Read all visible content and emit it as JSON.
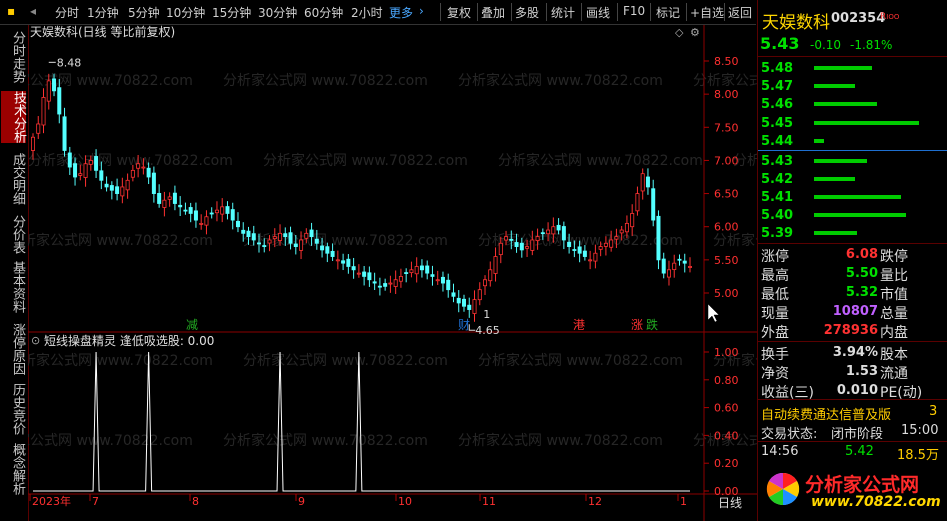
{
  "toolbar": {
    "items": [
      "分时",
      "1分钟",
      "5分钟",
      "10分钟",
      "15分钟",
      "30分钟",
      "60分钟",
      "2小时",
      "更多",
      "复权",
      "叠加",
      "多股",
      "统计",
      "画线",
      "F10",
      "标记",
      "+自选",
      "返回"
    ]
  },
  "side_tabs": [
    "分时走势",
    "技术分析",
    "成交明细",
    "分价表",
    "基本资料",
    "涨停原因",
    "历史竞价",
    "概念解析"
  ],
  "chart": {
    "title": "天娱数科(日线 等比前复权)",
    "watermark": "分析家公式网 www.70822.com",
    "y_ticks": [
      "8.50",
      "8.00",
      "7.50",
      "7.00",
      "6.50",
      "6.00",
      "5.50",
      "5.00"
    ],
    "high_label": "8.48",
    "low_label": "4.65",
    "marker_one": "1",
    "events": [
      "减",
      "财",
      "港",
      "涨",
      "跌"
    ],
    "indicator_label": "短线操盘精灵 逢低吸选股: 0.00",
    "ind_ticks": [
      "1.00",
      "0.80",
      "0.60",
      "0.40",
      "0.20",
      "0.00"
    ],
    "x_labels": [
      "2023年",
      "7",
      "8",
      "9",
      "10",
      "11",
      "12",
      "1"
    ],
    "x_corner": "日线",
    "up_color": "#ff3232",
    "down_color": "#54ffff"
  },
  "chart_data": {
    "type": "candlestick",
    "title": "天娱数科(日线 等比前复权)",
    "ylim": [
      4.6,
      8.7
    ],
    "closes": [
      7.35,
      7.55,
      7.95,
      8.2,
      8.05,
      7.7,
      7.15,
      6.9,
      6.75,
      6.8,
      6.95,
      7.0,
      6.85,
      6.7,
      6.6,
      6.55,
      6.5,
      6.6,
      6.7,
      6.85,
      6.95,
      6.9,
      6.75,
      6.5,
      6.35,
      6.4,
      6.45,
      6.35,
      6.3,
      6.25,
      6.2,
      6.1,
      6.05,
      6.15,
      6.2,
      6.25,
      6.3,
      6.2,
      6.1,
      6.0,
      5.9,
      5.85,
      5.8,
      5.75,
      5.7,
      5.8,
      5.85,
      5.9,
      5.85,
      5.75,
      5.7,
      5.8,
      5.9,
      5.85,
      5.75,
      5.65,
      5.6,
      5.55,
      5.5,
      5.45,
      5.4,
      5.35,
      5.3,
      5.25,
      5.2,
      5.15,
      5.1,
      5.1,
      5.15,
      5.2,
      5.25,
      5.3,
      5.35,
      5.4,
      5.35,
      5.3,
      5.25,
      5.2,
      5.15,
      5.05,
      4.95,
      4.85,
      4.8,
      4.75,
      4.9,
      5.05,
      5.2,
      5.35,
      5.55,
      5.75,
      5.85,
      5.8,
      5.7,
      5.65,
      5.7,
      5.8,
      5.85,
      5.9,
      5.95,
      6.0,
      5.95,
      5.8,
      5.7,
      5.65,
      5.6,
      5.55,
      5.5,
      5.6,
      5.7,
      5.75,
      5.8,
      5.85,
      5.95,
      6.05,
      6.2,
      6.5,
      6.8,
      6.6,
      6.1,
      5.5,
      5.3,
      5.35,
      5.45,
      5.5,
      5.45,
      5.4
    ],
    "indicator": {
      "name": "短线操盘精灵 逢低吸选股",
      "ylim": [
        0,
        1
      ],
      "spikes_at_bar": [
        12,
        22,
        47,
        62
      ]
    },
    "x_labels": [
      "2023年",
      "7",
      "8",
      "9",
      "10",
      "11",
      "12",
      "1"
    ]
  },
  "panel": {
    "stock_name": "天娱数科",
    "code": "002354",
    "badge": "R",
    "price": "5.43",
    "change": "-0.10",
    "change_pct": "-1.81%",
    "asks": [
      {
        "price": "5.48",
        "vol": 0.34
      },
      {
        "price": "5.47",
        "vol": 0.24
      },
      {
        "price": "5.46",
        "vol": 0.37
      },
      {
        "price": "5.45",
        "vol": 0.62
      },
      {
        "price": "5.44",
        "vol": 0.06
      }
    ],
    "bids": [
      {
        "price": "5.43",
        "vol": 0.31
      },
      {
        "price": "5.42",
        "vol": 0.24
      },
      {
        "price": "5.41",
        "vol": 0.51
      },
      {
        "price": "5.40",
        "vol": 0.54
      },
      {
        "price": "5.39",
        "vol": 0.25
      }
    ],
    "stats": [
      {
        "l": "涨停",
        "v": "6.08",
        "c": "#ff3232",
        "r": "跌停"
      },
      {
        "l": "最高",
        "v": "5.50",
        "c": "#00e000",
        "r": "量比"
      },
      {
        "l": "最低",
        "v": "5.32",
        "c": "#00e000",
        "r": "市值"
      },
      {
        "l": "现量",
        "v": "10807",
        "c": "#c060ff",
        "r": "总量"
      },
      {
        "l": "外盘",
        "v": "278936",
        "c": "#ff3232",
        "r": "内盘"
      }
    ],
    "stats2": [
      {
        "l": "换手",
        "v": "3.94%",
        "r": "股本"
      },
      {
        "l": "净资",
        "v": "1.53",
        "r": "流通"
      },
      {
        "l": "收益(三)",
        "v": "0.010",
        "r": "PE(动)"
      }
    ],
    "promo": "自动续费通达信普及版",
    "promo_tail": "3",
    "trade_state_label": "交易状态:",
    "trade_state": "闭市阶段",
    "trade_time": "15:00",
    "tick_time": "14:56",
    "tick_price": "5.42",
    "tick_vol": "18.5万",
    "logo_text": "分析家公式网",
    "logo_url": "www.70822.com"
  }
}
